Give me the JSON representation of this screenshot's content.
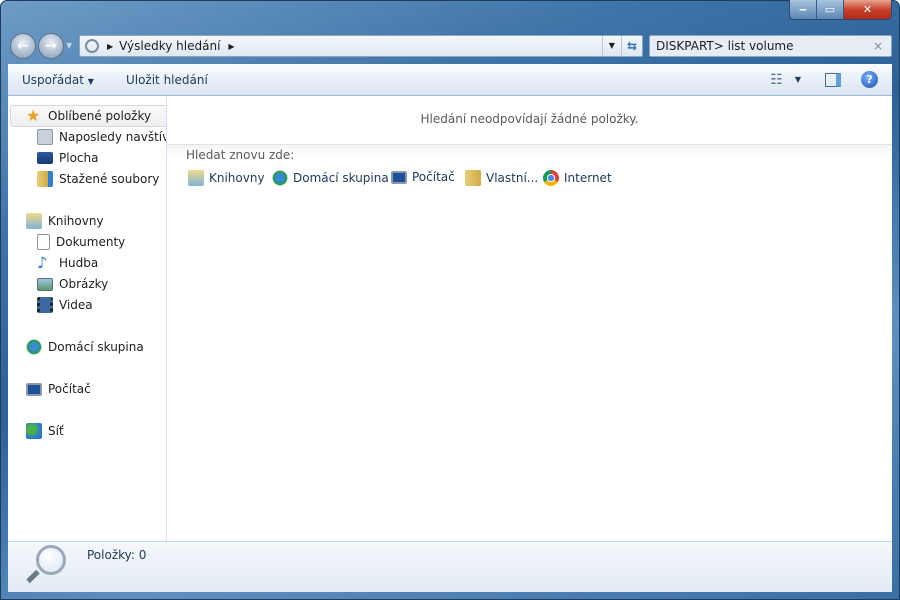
{
  "window": {
    "minimize": "minimize",
    "maximize": "maximize",
    "close": "close"
  },
  "address": {
    "crumbs": [
      "Výsledky hledání"
    ]
  },
  "search": {
    "value": "DISKPART> list volume"
  },
  "toolbar": {
    "organize": "Uspořádat",
    "save_search": "Uložit hledání"
  },
  "sidebar": {
    "items": [
      {
        "label": "Oblíbené položky",
        "icon": "star-icon"
      },
      {
        "label": "Naposledy navštívené",
        "icon": "recent-places-icon"
      },
      {
        "label": "Plocha",
        "icon": "desktop-icon"
      },
      {
        "label": "Stažené soubory",
        "icon": "downloads-icon"
      },
      {
        "label": "Knihovny",
        "icon": "libraries-icon"
      },
      {
        "label": "Dokumenty",
        "icon": "documents-icon"
      },
      {
        "label": "Hudba",
        "icon": "music-icon"
      },
      {
        "label": "Obrázky",
        "icon": "pictures-icon"
      },
      {
        "label": "Videa",
        "icon": "videos-icon"
      },
      {
        "label": "Domácí skupina",
        "icon": "homegroup-icon"
      },
      {
        "label": "Počítač",
        "icon": "computer-icon"
      },
      {
        "label": "Síť",
        "icon": "network-icon"
      }
    ]
  },
  "main": {
    "empty_message": "Hledání neodpovídají žádné položky.",
    "search_again": "Hledat znovu zde:",
    "locations": [
      {
        "label": "Knihovny",
        "icon": "libraries-icon"
      },
      {
        "label": "Domácí skupina",
        "icon": "homegroup-icon"
      },
      {
        "label": "Počítač",
        "icon": "computer-icon"
      },
      {
        "label": "Vlastní...",
        "icon": "custom-folder-icon"
      },
      {
        "label": "Internet",
        "icon": "chrome-icon"
      }
    ]
  },
  "status": {
    "items": "Položky: 0"
  }
}
